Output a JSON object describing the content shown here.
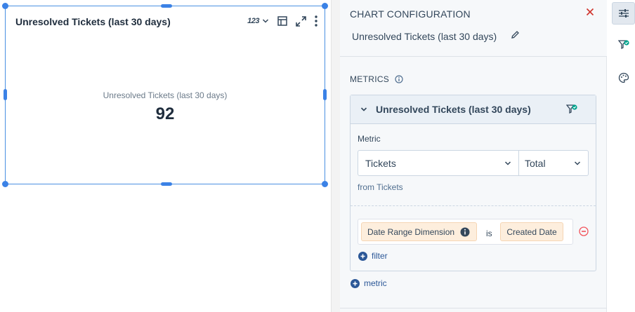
{
  "widget": {
    "title": "Unresolved Tickets (last 30 days)",
    "metric_type_label": "123",
    "metric_label": "Unresolved Tickets (last 30 days)",
    "metric_value": "92"
  },
  "panel": {
    "title": "CHART CONFIGURATION",
    "chart_name": "Unresolved Tickets (last 30 days)",
    "metrics_heading": "METRICS",
    "metric_card": {
      "title": "Unresolved Tickets (last 30 days)",
      "metric_label": "Metric",
      "source": "Tickets",
      "aggregation": "Total",
      "from_text": "from Tickets",
      "filter": {
        "dimension": "Date Range Dimension",
        "operator": "is",
        "value": "Created Date"
      },
      "add_filter_label": "filter"
    },
    "add_metric_label": "metric"
  },
  "colors": {
    "selection": "#3b82e6",
    "close": "#d0342c",
    "link": "#2b5797",
    "chip_bg": "#fdeedd",
    "filter_badge": "#00a38d",
    "remove": "#f2545b"
  },
  "icons": {
    "rail": [
      "sliders-icon",
      "filter-check-icon",
      "palette-icon"
    ]
  }
}
